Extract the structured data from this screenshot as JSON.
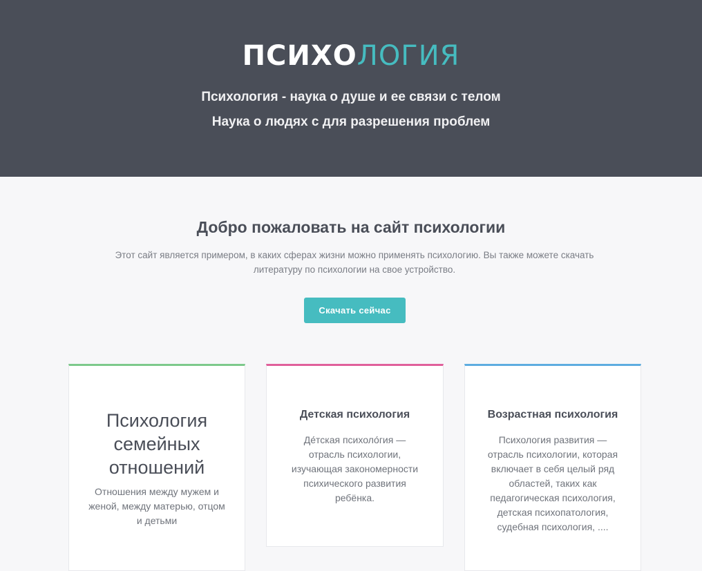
{
  "hero": {
    "logo_bold": "ПСИХО",
    "logo_light": "ЛОГИЯ",
    "tagline_1": "Психология - наука о душе и ее связи с телом",
    "tagline_2": "Наука о людях с для разрешения проблем"
  },
  "welcome": {
    "title": "Добро пожаловать на сайт психологии",
    "text": "Этот сайт является примером, в каких сферах жизни можно применять психологию. Вы также можете скачать литературу по психологии на свое устройство.",
    "button_label": "Скачать сейчас"
  },
  "cards": [
    {
      "title": "Психология семейных отношений",
      "text": "Отношения между мужем и женой, между матерью, отцом и детьми",
      "accent": "#7dc98b"
    },
    {
      "title": "Детская психология",
      "text": "Де́тская психоло́гия — отрасль психологии, изучающая закономерности психического развития ребёнка.",
      "accent": "#e0609b"
    },
    {
      "title": "Возрастная психология",
      "text": "Психология развития — отрасль психологии, которая включает в себя целый ряд областей, таких как педагогическая психология, детская психопатология, судебная психология, ....",
      "accent": "#5dace0"
    }
  ],
  "colors": {
    "hero_bg": "#4a4e58",
    "accent_teal": "#46bcc0",
    "page_bg": "#f7f7f9"
  }
}
